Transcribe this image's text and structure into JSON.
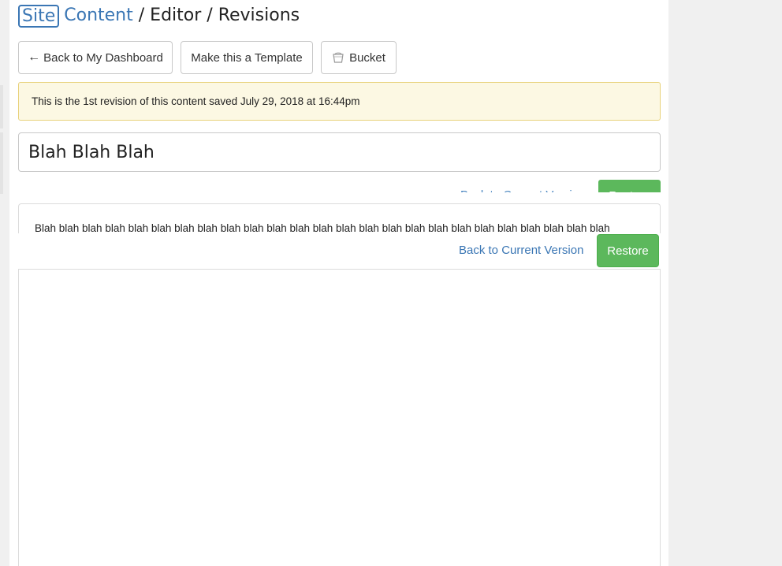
{
  "breadcrumb": {
    "site": "Site",
    "content": "Content",
    "separator": "/",
    "editor": "Editor",
    "revisions": "Revisions"
  },
  "toolbar": {
    "back_label": "Back to My Dashboard",
    "template_label": "Make this a Template",
    "bucket_label": "Bucket"
  },
  "alert": {
    "message": "This is the 1st revision of this content saved July 29, 2018 at 16:44pm"
  },
  "title_field": {
    "value": "Blah Blah Blah"
  },
  "content": {
    "body": "Blah blah blah blah blah blah blah blah blah blah blah blah blah blah blah blah blah blah blah blah blah blah blah blah blah"
  },
  "actions": {
    "back_to_current": "Back to Current Version",
    "restore": "Restore"
  },
  "colors": {
    "link": "#3a76b4",
    "success": "#5cb85c",
    "alert_bg": "#fcf8e3",
    "alert_border": "#e8d27c"
  }
}
